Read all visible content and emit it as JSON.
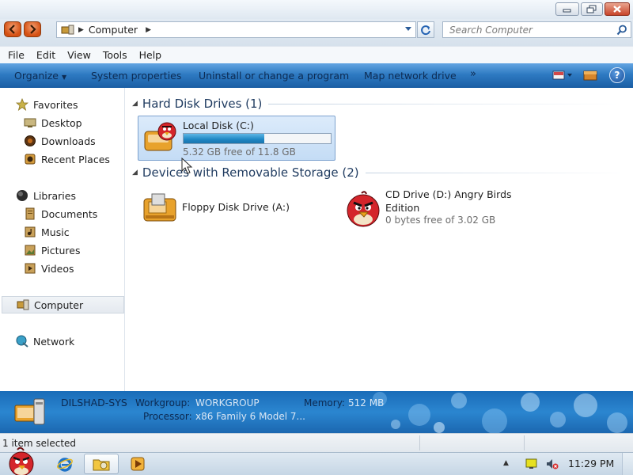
{
  "window": {
    "title": "",
    "colors": {
      "accent": "#2e7ac2",
      "selection": "#c4dcf5",
      "close": "#c8442a"
    }
  },
  "address": {
    "breadcrumb": "Computer",
    "search_placeholder": "Search Computer"
  },
  "menu": [
    "File",
    "Edit",
    "View",
    "Tools",
    "Help"
  ],
  "commands": {
    "organize": "Organize",
    "system_properties": "System properties",
    "uninstall": "Uninstall or change a program",
    "map_drive": "Map network drive",
    "more": "»"
  },
  "sidebar": {
    "favorites": {
      "label": "Favorites",
      "icon": "star-icon",
      "items": [
        {
          "label": "Desktop",
          "icon": "desktop-icon"
        },
        {
          "label": "Downloads",
          "icon": "downloads-icon"
        },
        {
          "label": "Recent Places",
          "icon": "recent-places-icon"
        }
      ]
    },
    "libraries": {
      "label": "Libraries",
      "icon": "libraries-icon",
      "items": [
        {
          "label": "Documents",
          "icon": "documents-icon"
        },
        {
          "label": "Music",
          "icon": "music-icon"
        },
        {
          "label": "Pictures",
          "icon": "pictures-icon"
        },
        {
          "label": "Videos",
          "icon": "videos-icon"
        }
      ]
    },
    "computer": {
      "label": "Computer",
      "icon": "computer-icon"
    },
    "network": {
      "label": "Network",
      "icon": "network-icon"
    }
  },
  "groups": {
    "hard_disks": {
      "title": "Hard Disk Drives (1)",
      "drives": [
        {
          "name": "Local Disk (C:)",
          "free": "5.32 GB free of 11.8 GB",
          "used_fraction": 0.55,
          "icon": "hard-disk-icon"
        }
      ]
    },
    "removable": {
      "title": "Devices with Removable Storage (2)",
      "drives": [
        {
          "name": "Floppy Disk Drive (A:)",
          "icon": "floppy-drive-icon"
        },
        {
          "name": "CD Drive (D:) Angry Birds Edition",
          "free": "0 bytes free of 3.02 GB",
          "icon": "angry-bird-cd-icon"
        }
      ]
    }
  },
  "details": {
    "computer_name": "DILSHAD-SYS",
    "workgroup_label": "Workgroup:",
    "workgroup": "WORKGROUP",
    "memory_label": "Memory:",
    "memory": "512 MB",
    "processor_label": "Processor:",
    "processor": "x86 Family 6 Model 7..."
  },
  "status": {
    "text": "1 item selected"
  },
  "taskbar": {
    "clock": "11:29 PM"
  }
}
